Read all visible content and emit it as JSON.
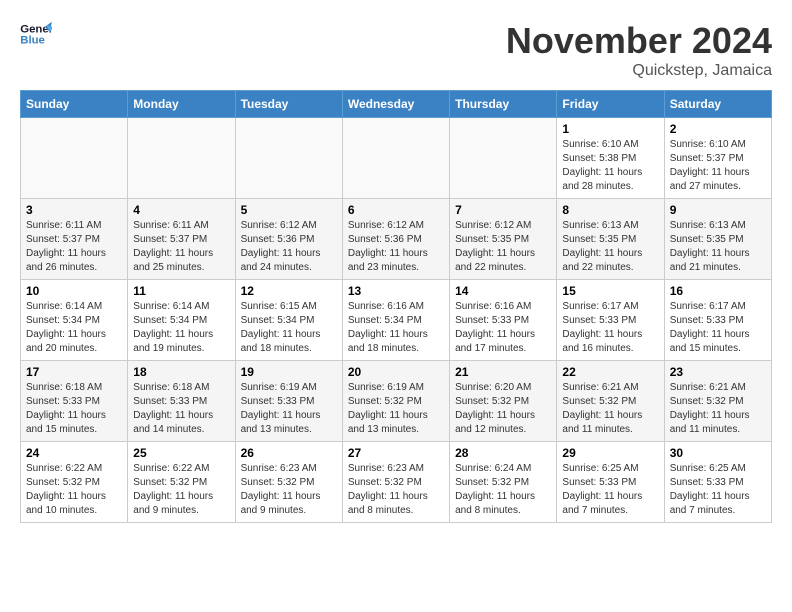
{
  "header": {
    "logo_line1": "General",
    "logo_line2": "Blue",
    "month": "November 2024",
    "location": "Quickstep, Jamaica"
  },
  "days_of_week": [
    "Sunday",
    "Monday",
    "Tuesday",
    "Wednesday",
    "Thursday",
    "Friday",
    "Saturday"
  ],
  "weeks": [
    [
      {
        "day": "",
        "info": ""
      },
      {
        "day": "",
        "info": ""
      },
      {
        "day": "",
        "info": ""
      },
      {
        "day": "",
        "info": ""
      },
      {
        "day": "",
        "info": ""
      },
      {
        "day": "1",
        "info": "Sunrise: 6:10 AM\nSunset: 5:38 PM\nDaylight: 11 hours\nand 28 minutes."
      },
      {
        "day": "2",
        "info": "Sunrise: 6:10 AM\nSunset: 5:37 PM\nDaylight: 11 hours\nand 27 minutes."
      }
    ],
    [
      {
        "day": "3",
        "info": "Sunrise: 6:11 AM\nSunset: 5:37 PM\nDaylight: 11 hours\nand 26 minutes."
      },
      {
        "day": "4",
        "info": "Sunrise: 6:11 AM\nSunset: 5:37 PM\nDaylight: 11 hours\nand 25 minutes."
      },
      {
        "day": "5",
        "info": "Sunrise: 6:12 AM\nSunset: 5:36 PM\nDaylight: 11 hours\nand 24 minutes."
      },
      {
        "day": "6",
        "info": "Sunrise: 6:12 AM\nSunset: 5:36 PM\nDaylight: 11 hours\nand 23 minutes."
      },
      {
        "day": "7",
        "info": "Sunrise: 6:12 AM\nSunset: 5:35 PM\nDaylight: 11 hours\nand 22 minutes."
      },
      {
        "day": "8",
        "info": "Sunrise: 6:13 AM\nSunset: 5:35 PM\nDaylight: 11 hours\nand 22 minutes."
      },
      {
        "day": "9",
        "info": "Sunrise: 6:13 AM\nSunset: 5:35 PM\nDaylight: 11 hours\nand 21 minutes."
      }
    ],
    [
      {
        "day": "10",
        "info": "Sunrise: 6:14 AM\nSunset: 5:34 PM\nDaylight: 11 hours\nand 20 minutes."
      },
      {
        "day": "11",
        "info": "Sunrise: 6:14 AM\nSunset: 5:34 PM\nDaylight: 11 hours\nand 19 minutes."
      },
      {
        "day": "12",
        "info": "Sunrise: 6:15 AM\nSunset: 5:34 PM\nDaylight: 11 hours\nand 18 minutes."
      },
      {
        "day": "13",
        "info": "Sunrise: 6:16 AM\nSunset: 5:34 PM\nDaylight: 11 hours\nand 18 minutes."
      },
      {
        "day": "14",
        "info": "Sunrise: 6:16 AM\nSunset: 5:33 PM\nDaylight: 11 hours\nand 17 minutes."
      },
      {
        "day": "15",
        "info": "Sunrise: 6:17 AM\nSunset: 5:33 PM\nDaylight: 11 hours\nand 16 minutes."
      },
      {
        "day": "16",
        "info": "Sunrise: 6:17 AM\nSunset: 5:33 PM\nDaylight: 11 hours\nand 15 minutes."
      }
    ],
    [
      {
        "day": "17",
        "info": "Sunrise: 6:18 AM\nSunset: 5:33 PM\nDaylight: 11 hours\nand 15 minutes."
      },
      {
        "day": "18",
        "info": "Sunrise: 6:18 AM\nSunset: 5:33 PM\nDaylight: 11 hours\nand 14 minutes."
      },
      {
        "day": "19",
        "info": "Sunrise: 6:19 AM\nSunset: 5:33 PM\nDaylight: 11 hours\nand 13 minutes."
      },
      {
        "day": "20",
        "info": "Sunrise: 6:19 AM\nSunset: 5:32 PM\nDaylight: 11 hours\nand 13 minutes."
      },
      {
        "day": "21",
        "info": "Sunrise: 6:20 AM\nSunset: 5:32 PM\nDaylight: 11 hours\nand 12 minutes."
      },
      {
        "day": "22",
        "info": "Sunrise: 6:21 AM\nSunset: 5:32 PM\nDaylight: 11 hours\nand 11 minutes."
      },
      {
        "day": "23",
        "info": "Sunrise: 6:21 AM\nSunset: 5:32 PM\nDaylight: 11 hours\nand 11 minutes."
      }
    ],
    [
      {
        "day": "24",
        "info": "Sunrise: 6:22 AM\nSunset: 5:32 PM\nDaylight: 11 hours\nand 10 minutes."
      },
      {
        "day": "25",
        "info": "Sunrise: 6:22 AM\nSunset: 5:32 PM\nDaylight: 11 hours\nand 9 minutes."
      },
      {
        "day": "26",
        "info": "Sunrise: 6:23 AM\nSunset: 5:32 PM\nDaylight: 11 hours\nand 9 minutes."
      },
      {
        "day": "27",
        "info": "Sunrise: 6:23 AM\nSunset: 5:32 PM\nDaylight: 11 hours\nand 8 minutes."
      },
      {
        "day": "28",
        "info": "Sunrise: 6:24 AM\nSunset: 5:32 PM\nDaylight: 11 hours\nand 8 minutes."
      },
      {
        "day": "29",
        "info": "Sunrise: 6:25 AM\nSunset: 5:33 PM\nDaylight: 11 hours\nand 7 minutes."
      },
      {
        "day": "30",
        "info": "Sunrise: 6:25 AM\nSunset: 5:33 PM\nDaylight: 11 hours\nand 7 minutes."
      }
    ]
  ]
}
